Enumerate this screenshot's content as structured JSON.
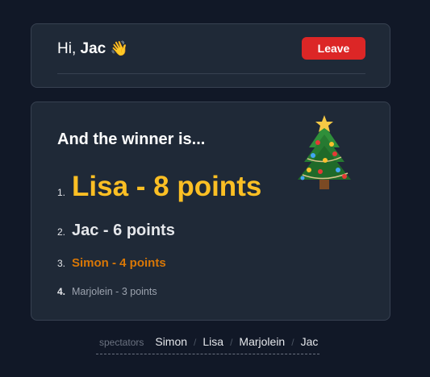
{
  "header": {
    "greeting_prefix": "Hi,",
    "user_name": "Jac",
    "leave_label": "Leave"
  },
  "results": {
    "heading": "And the winner is...",
    "decoration_icon": "christmas-tree-icon",
    "ranking": [
      {
        "position": "1.",
        "text": "Lisa - 8 points"
      },
      {
        "position": "2.",
        "text": "Jac - 6 points"
      },
      {
        "position": "3.",
        "text": "Simon - 4 points"
      },
      {
        "position": "4.",
        "text": "Marjolein - 3 points"
      }
    ]
  },
  "spectators": {
    "label": "spectators",
    "names": [
      "Simon",
      "Lisa",
      "Marjolein",
      "Jac"
    ],
    "separator": "/"
  },
  "colors": {
    "background": "#111827",
    "card": "#1f2937",
    "leave_button": "#dc2626",
    "first_place": "#fbbf24",
    "third_place": "#d97706"
  }
}
